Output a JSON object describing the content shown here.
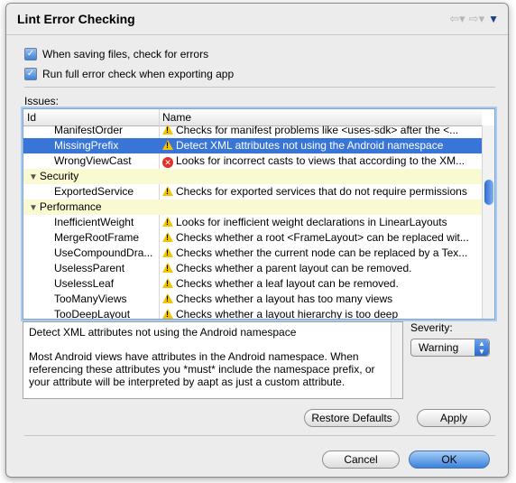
{
  "window": {
    "title": "Lint Error Checking"
  },
  "options": {
    "check_on_save": {
      "label": "When saving files, check for errors",
      "checked": true
    },
    "check_on_export": {
      "label": "Run full error check when exporting app",
      "checked": true
    }
  },
  "issues": {
    "label": "Issues:",
    "columns": {
      "id": "Id",
      "name": "Name"
    },
    "rows": [
      {
        "type": "issue",
        "id": "ManifestOrder",
        "icon": "warning-icon",
        "name": "Checks for manifest problems like <uses-sdk> after the <..."
      },
      {
        "type": "issue",
        "id": "MissingPrefix",
        "icon": "warning-icon",
        "name": "Detect XML attributes not using the Android namespace",
        "selected": true
      },
      {
        "type": "issue",
        "id": "WrongViewCast",
        "icon": "error-icon",
        "name": "Looks for incorrect casts to views that according to the XM..."
      },
      {
        "type": "category",
        "id": "Security",
        "name": ""
      },
      {
        "type": "issue",
        "id": "ExportedService",
        "icon": "warning-icon",
        "name": "Checks for exported services that do not require permissions"
      },
      {
        "type": "category",
        "id": "Performance",
        "name": ""
      },
      {
        "type": "issue",
        "id": "InefficientWeight",
        "icon": "warning-icon",
        "name": "Looks for inefficient weight declarations in LinearLayouts"
      },
      {
        "type": "issue",
        "id": "MergeRootFrame",
        "icon": "warning-icon",
        "name": "Checks whether a root <FrameLayout> can be replaced wit..."
      },
      {
        "type": "issue",
        "id": "UseCompoundDra...",
        "icon": "warning-icon",
        "name": "Checks whether the current node can be replaced by a Tex..."
      },
      {
        "type": "issue",
        "id": "UselessParent",
        "icon": "warning-icon",
        "name": "Checks whether a parent layout can be removed."
      },
      {
        "type": "issue",
        "id": "UselessLeaf",
        "icon": "warning-icon",
        "name": "Checks whether a leaf layout can be removed."
      },
      {
        "type": "issue",
        "id": "TooManyViews",
        "icon": "warning-icon",
        "name": "Checks whether a layout has too many views"
      },
      {
        "type": "issue",
        "id": "TooDeepLayout",
        "icon": "warning-icon",
        "name": "Checks whether a layout hierarchy is too deep"
      }
    ]
  },
  "description": {
    "summary": "Detect XML attributes not using the Android namespace",
    "body": "Most Android views have attributes in the Android namespace. When referencing these attributes you *must* include the namespace prefix, or your attribute will be interpreted by aapt as just a custom attribute."
  },
  "severity": {
    "label": "Severity:",
    "value": "Warning"
  },
  "buttons": {
    "restore_defaults": "Restore Defaults",
    "apply": "Apply",
    "cancel": "Cancel",
    "ok": "OK"
  },
  "colors": {
    "selection": "#3875d7",
    "category_bg": "#fafad2",
    "default_button": "#3b82dc"
  }
}
